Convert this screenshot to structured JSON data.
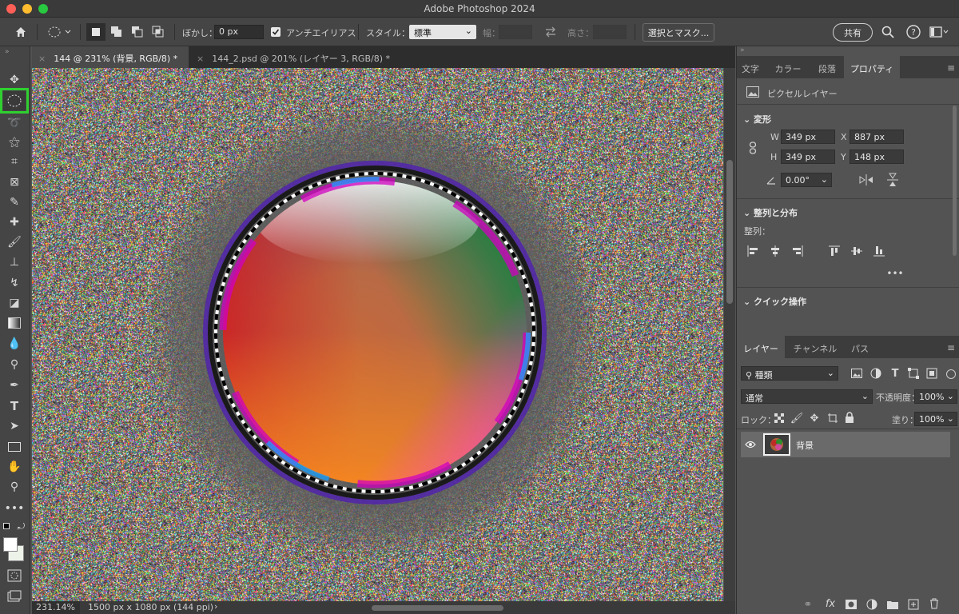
{
  "window": {
    "title": "Adobe Photoshop 2024"
  },
  "options_bar": {
    "feather_label": "ぼかし：",
    "feather_value": "0 px",
    "antialias_label": "アンチエイリアス",
    "style_label": "スタイル：",
    "style_value": "標準",
    "width_label": "幅：",
    "height_label": "高さ：",
    "select_mask_label": "選択とマスク...",
    "share_label": "共有"
  },
  "tabs": [
    {
      "label": "144 @ 231% (背景, RGB/8) *",
      "active": true
    },
    {
      "label": "144_2.psd @ 201% (レイヤー 3, RGB/8) *",
      "active": false
    }
  ],
  "status": {
    "zoom": "231.14%",
    "doc_info": "1500 px x 1080 px (144 ppi)"
  },
  "properties_panel": {
    "tabs": [
      "文字",
      "カラー",
      "段落",
      "プロパティ"
    ],
    "active_tab": "プロパティ",
    "layer_type": "ピクセルレイヤー",
    "transform": {
      "title": "変形",
      "w_label": "W",
      "w_value": "349 px",
      "h_label": "H",
      "h_value": "349 px",
      "x_label": "X",
      "x_value": "887 px",
      "y_label": "Y",
      "y_value": "148 px",
      "angle_value": "0.00°"
    },
    "align": {
      "title": "整列と分布",
      "label": "整列："
    },
    "quick_actions": {
      "title": "クイック操作"
    }
  },
  "layers_panel": {
    "tabs": [
      "レイヤー",
      "チャンネル",
      "パス"
    ],
    "active_tab": "レイヤー",
    "filter_value": "種類",
    "blend_mode": "通常",
    "opacity_label": "不透明度：",
    "opacity_value": "100%",
    "lock_label": "ロック：",
    "fill_label": "塗り：",
    "fill_value": "100%",
    "layers": [
      {
        "name": "背景",
        "visible": true
      }
    ]
  }
}
